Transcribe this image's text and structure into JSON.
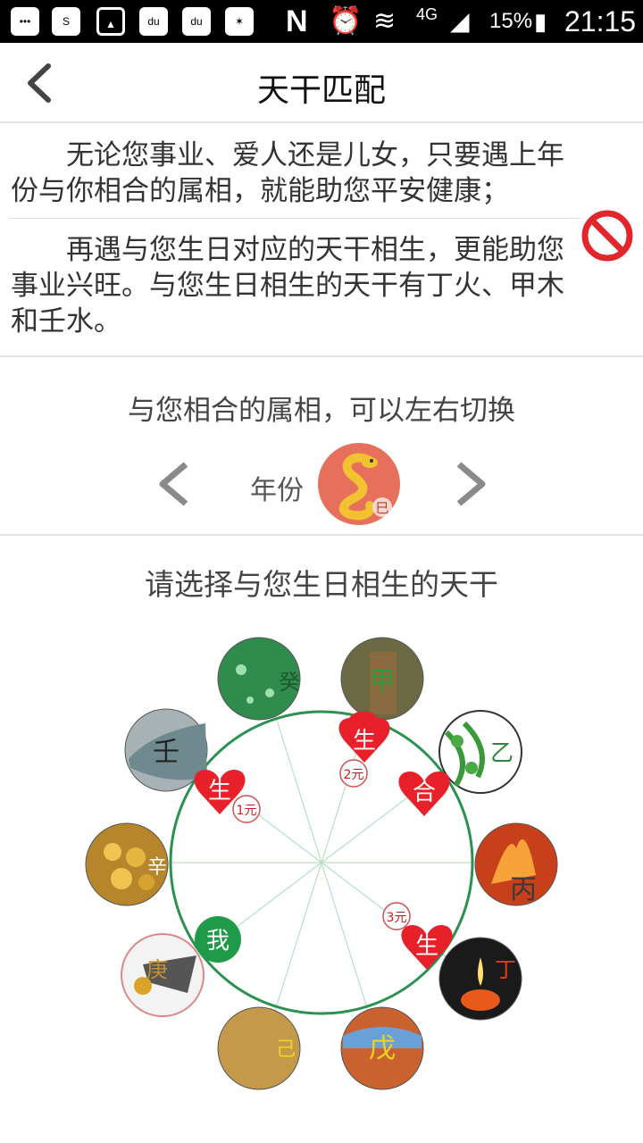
{
  "status_bar": {
    "network": "4G",
    "battery": "15%",
    "time": "21:15"
  },
  "header": {
    "title": "天干匹配"
  },
  "intro": {
    "para1": "无论您事业、爱人还是儿女，只要遇上年份与你相合的属相，就能助您平安健康；",
    "para2": "再遇与您生日对应的天干相生，更能助您事业兴旺。与您生日相生的天干有丁火、甲木和壬水。"
  },
  "zodiac_switch": {
    "hint": "与您相合的属相，可以左右切换",
    "year_label": "年份",
    "zodiac_branch": "巳"
  },
  "stem_select": {
    "title": "请选择与您生日相生的天干",
    "stems": [
      "甲",
      "乙",
      "丙",
      "丁",
      "戊",
      "己",
      "庚",
      "辛",
      "壬",
      "癸"
    ],
    "center_label": "我",
    "relations": [
      {
        "label": "生",
        "price": "2元"
      },
      {
        "label": "合"
      },
      {
        "label": "生",
        "price": "1元"
      },
      {
        "label": "生",
        "price": "3元"
      }
    ]
  },
  "colors": {
    "circle": "#2a9150",
    "heart": "#e8202a",
    "me": "#1f9a48"
  }
}
